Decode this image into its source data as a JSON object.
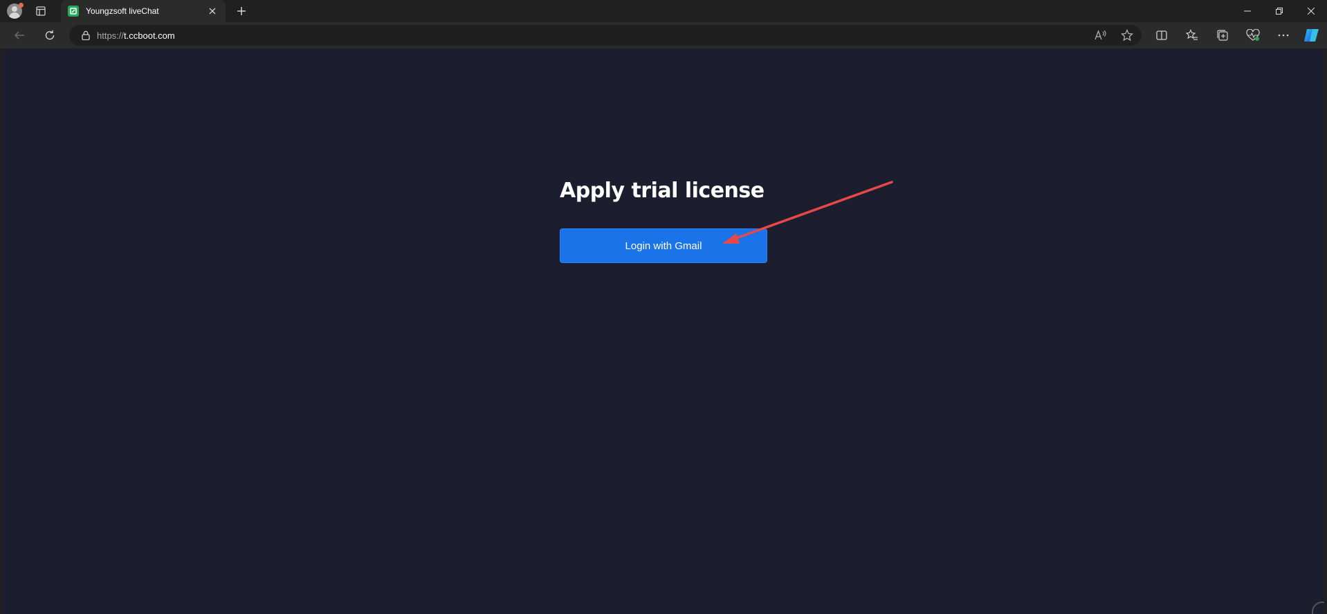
{
  "browser": {
    "tab": {
      "title": "Youngzsoft liveChat",
      "favicon": "livechat-favicon"
    },
    "address": {
      "prefix": "https://",
      "host": "t.ccboot.com"
    },
    "icons": {
      "back": "back-arrow-icon",
      "refresh": "refresh-icon",
      "lock": "lock-icon",
      "read_aloud": "read-aloud-icon",
      "favorite": "star-icon",
      "split_screen": "split-screen-icon",
      "favorites": "favorites-icon",
      "collections": "collections-icon",
      "browser_essentials": "heart-pulse-icon",
      "more": "more-icon",
      "copilot": "copilot-icon"
    },
    "accent": "#1a73e8"
  },
  "page": {
    "heading": "Apply trial license",
    "login_button": "Login with Gmail",
    "background": "#1c1d2e",
    "annotation_color": "#e84848"
  }
}
